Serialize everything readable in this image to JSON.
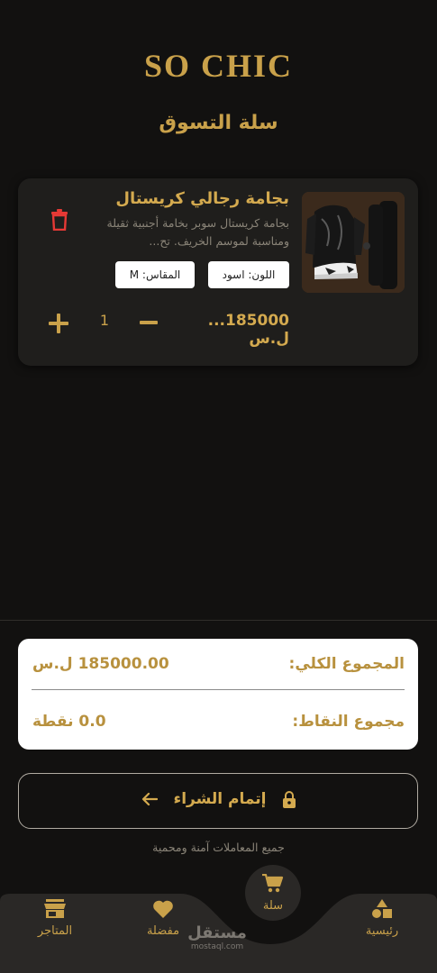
{
  "header": {
    "brand": "SO CHIC",
    "title": "سلة التسوق"
  },
  "cart": {
    "items": [
      {
        "name": "بجامة رجالي كريستال",
        "description": "بجامة كريستال سوبر بخامة أجنبية ثقيلة ومناسبة لموسم الخريف. تح...",
        "color_chip": "اللون: اسود",
        "size_chip": "المقاس: M",
        "price": "185000... ل.س",
        "quantity": "1"
      }
    ]
  },
  "summary": {
    "total_label": "المجموع الكلي:",
    "total_value": "185000.00 ل.س",
    "points_label": "مجموع النقاط:",
    "points_value": "0.0 نقطة"
  },
  "checkout": {
    "label": "إتمام الشراء"
  },
  "secure_note": "جميع المعاملات آمنة ومحمية",
  "bottom_nav": {
    "home": "رئيسية",
    "cart": "سلة",
    "favorites": "مفضلة",
    "stores": "المتاجر"
  },
  "watermark": {
    "arabic": "مستقل",
    "latin": "mostaql.com"
  },
  "colors": {
    "background": "#121110",
    "accent_gold": "#c9a14a",
    "card": "#1f1e1c",
    "delete_red": "#e53935"
  },
  "icons": [
    "trash-icon",
    "plus-icon",
    "minus-icon",
    "lock-icon",
    "arrow-left-icon",
    "home-shapes-icon",
    "cart-icon",
    "heart-icon",
    "store-icon"
  ]
}
